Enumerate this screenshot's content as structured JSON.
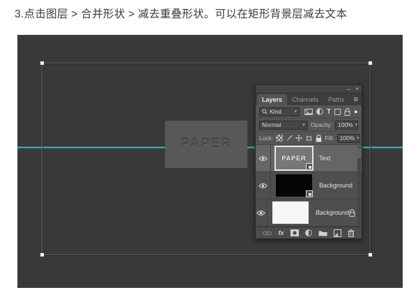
{
  "title": "3.点击图层 > 合并形状 > 减去重叠形状。可以在矩形背景层减去文本",
  "canvas": {
    "paper_text": "PAPER"
  },
  "panel": {
    "tabs": [
      {
        "label": "Layers",
        "active": true
      },
      {
        "label": "Channels",
        "active": false
      },
      {
        "label": "Paths",
        "active": false
      }
    ],
    "filter": {
      "kind_label": "Kind"
    },
    "blend": {
      "mode": "Normal",
      "opacity_label": "Opacity:",
      "opacity_value": "100%"
    },
    "lock": {
      "label": "Lock:",
      "fill_label": "Fill:",
      "fill_value": "100%"
    },
    "layers": [
      {
        "name": "Text",
        "thumb_text": "PAPER",
        "selected": true,
        "thumb": "gray"
      },
      {
        "name": "Background",
        "thumb": "black",
        "selected": false
      },
      {
        "name": "Background",
        "thumb": "white",
        "locked": true,
        "italic": true,
        "selected": false
      }
    ]
  },
  "icons": {
    "collapse": "↔",
    "close": "×",
    "menu": "≡",
    "caret": "▾",
    "text_tool": "T",
    "filter_toggle": "●",
    "fx": "fx"
  },
  "colors": {
    "canvas_bg": "#393939",
    "guide": "#56c2be",
    "panel_bg": "#4f4f4f",
    "selected_row": "#656565",
    "handle": "#f2f2f2"
  }
}
